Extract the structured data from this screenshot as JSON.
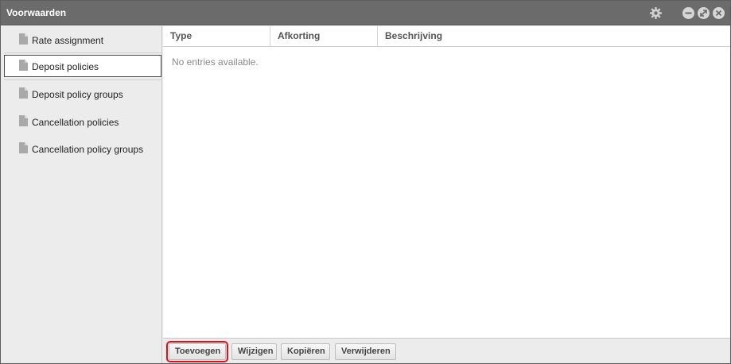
{
  "window": {
    "title": "Voorwaarden",
    "icons": [
      "gear-icon",
      "minimize-icon",
      "restore-icon",
      "close-icon"
    ]
  },
  "sidebar": {
    "items": [
      {
        "label": "Rate assignment",
        "icon": "document-icon",
        "active": false
      },
      {
        "label": "Deposit policies",
        "icon": "document-icon",
        "active": true
      },
      {
        "label": "Deposit policy groups",
        "icon": "document-icon",
        "active": false
      },
      {
        "label": "Cancellation policies",
        "icon": "document-icon",
        "active": false
      },
      {
        "label": "Cancellation policy groups",
        "icon": "document-icon",
        "active": false
      }
    ]
  },
  "table": {
    "columns": [
      "Type",
      "Afkorting",
      "Beschrijving"
    ],
    "rows": [],
    "empty_text": "No entries available."
  },
  "footer": {
    "add_label": "Toevoegen",
    "edit_label": "Wijzigen",
    "copy_label": "Kopiëren",
    "delete_label": "Verwijderen"
  },
  "colors": {
    "titlebar": "#6b6b6b",
    "highlight": "#e0101a"
  }
}
